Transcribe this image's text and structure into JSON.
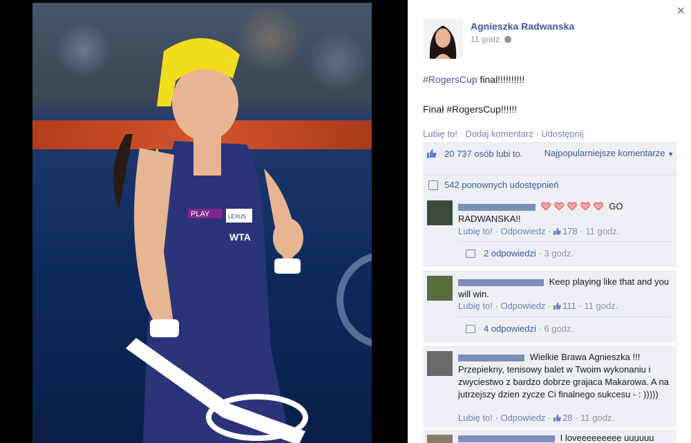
{
  "post": {
    "author": "Agnieszka Radwanska",
    "time": "11 godz.",
    "line1_tag": "#RogersCup",
    "line1_rest": " final!!!!!!!!!!",
    "line2": "Finał #RogersCup!!!!!!",
    "actions": {
      "like": "Lubię to!",
      "comment": "Dodaj komentarz",
      "share": "Udostępnij"
    },
    "likes_count": "20 737 osób lubi to.",
    "popular": "Najpopularniejsze komentarze",
    "shares": "542 ponownych udostępnień"
  },
  "comments": [
    {
      "text": "GO RADWANSKA!!",
      "hearts": 5,
      "like_label": "Lubię to!",
      "reply_label": "Odpowiedz",
      "likes": "178",
      "time": "11 godz.",
      "replies": "2 odpowiedzi",
      "replies_time": "3 godz."
    },
    {
      "text": "Keep playing like that and you will win.",
      "like_label": "Lubię to!",
      "reply_label": "Odpowiedz",
      "likes": "111",
      "time": "11 godz.",
      "replies": "4 odpowiedzi",
      "replies_time": "6 godz."
    },
    {
      "text": "Wielkie Brawa Agnieszka !!! Przepiekny, tenisowy balet w Twoim wykonaniu i zwyciestwo z bardzo dobrze grajaca Makarowa. A na jutrzejszy dzien zycze Ci finalnego sukcesu - : )))))",
      "like_label": "Lubię to!",
      "reply_label": "Odpowiedz",
      "likes": "28",
      "time": "11 godz."
    },
    {
      "text": "I loveeeeeeeee uuuuuu"
    }
  ],
  "photo_text": {
    "sponsor": "PLAY",
    "brand": "LEXUS",
    "league": "WTA"
  },
  "icons": [
    "close-icon",
    "globe-icon",
    "thumbs-up-icon",
    "share-icon",
    "reply-icon",
    "heart-icon"
  ]
}
